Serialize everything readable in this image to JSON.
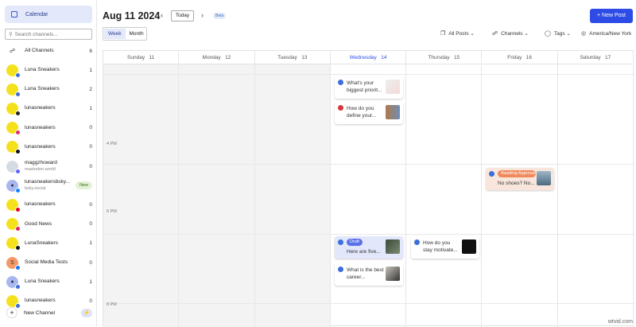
{
  "sidebar": {
    "nav": "Calendar",
    "search_placeholder": "Search channels...",
    "all_channels": {
      "label": "All Channels",
      "count": "6"
    },
    "channels": [
      {
        "name": "Luna Sneakers",
        "count": "1",
        "badge": "#3b6ed8"
      },
      {
        "name": "Luna Sneakers",
        "count": "2",
        "badge": "#3b6ed8"
      },
      {
        "name": "lunasneakers",
        "count": "1",
        "badge": "#222222"
      },
      {
        "name": "lunasneakers",
        "count": "0",
        "badge": "#e1306c"
      },
      {
        "name": "lunasneakers",
        "count": "0",
        "badge": "#111111"
      },
      {
        "name": "maggzhoward",
        "sub": "mastodon.world",
        "count": "0",
        "badge": "#6364ff",
        "avatar": "gray"
      },
      {
        "name": "lunasneakersbsky...",
        "sub": "bsky.social",
        "count": "New",
        "badge": "#1185fe",
        "avatar": "person"
      },
      {
        "name": "lunasneakers",
        "count": "0",
        "badge": "#e60023"
      },
      {
        "name": "Good News",
        "count": "0",
        "badge": "#e0245e"
      },
      {
        "name": "LunaSneakers",
        "count": "1",
        "badge": "#111111"
      },
      {
        "name": "Social Media Tests",
        "count": "0",
        "badge": "#1877f2",
        "avatar": "S"
      },
      {
        "name": "Luna Sneakers",
        "count": "1",
        "badge": "#3b6ed8",
        "avatar": "person"
      },
      {
        "name": "lunasneakers",
        "count": "0",
        "badge": "#3b6ed8"
      }
    ],
    "new_channel": "New Channel"
  },
  "header": {
    "title": "Aug 11 2024",
    "today": "Today",
    "beta": "Beta",
    "new_post": "+ New Post",
    "views": [
      "Week",
      "Month"
    ],
    "filters": [
      "All Posts",
      "Channels",
      "Tags",
      "America/New York"
    ]
  },
  "calendar": {
    "days": [
      {
        "name": "Sunday",
        "num": "11"
      },
      {
        "name": "Monday",
        "num": "12"
      },
      {
        "name": "Tuesday",
        "num": "13"
      },
      {
        "name": "Wednesday",
        "num": "14"
      },
      {
        "name": "Thursday",
        "num": "15"
      },
      {
        "name": "Friday",
        "num": "16"
      },
      {
        "name": "Saturday",
        "num": "17"
      }
    ],
    "current_day": "Wednesday",
    "time_labels": [
      "4 PM",
      "6 PM",
      "8 PM"
    ],
    "posts": [
      {
        "day": "Wednesday",
        "text": "What's your biggest priorit...",
        "icon": "#3b6ed8"
      },
      {
        "day": "Wednesday",
        "text": "How do you define your...",
        "icon": "#d8343c"
      },
      {
        "day": "Friday",
        "status": "Awaiting Approval",
        "text": "No shoes? No...",
        "icon": "#3b6ed8"
      },
      {
        "day": "Wednesday",
        "status": "Draft",
        "text": "Here are five...",
        "icon": "#3b6ed8"
      },
      {
        "day": "Wednesday",
        "text": "What is the best career...",
        "icon": "#3b6ed8"
      },
      {
        "day": "Thursday",
        "text": "How do you stay motivate...",
        "icon": "#3b6ed8"
      }
    ]
  },
  "colors": {
    "accent": "#2d4ce6",
    "draft": "#5a72e8",
    "awaiting": "#f08a5d"
  },
  "watermark": "wtvid.com"
}
